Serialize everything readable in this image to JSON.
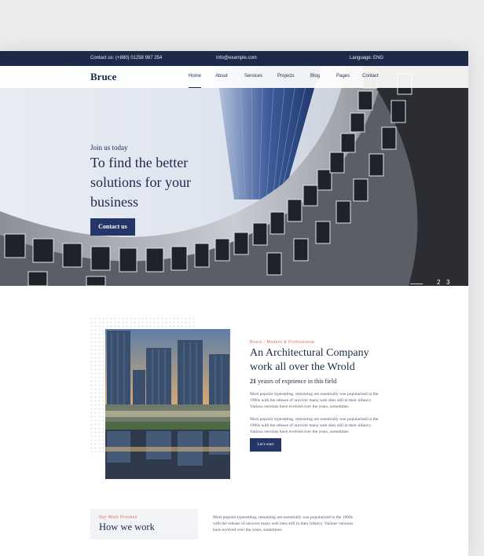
{
  "topbar": {
    "contact": "Contact us: (+880) 01258 987 254",
    "email": "Info@example.com",
    "language": "Language: ENG"
  },
  "brand": {
    "logo": "Bruce"
  },
  "nav": {
    "items": [
      "Home",
      "About",
      "Services",
      "Projects",
      "Blog",
      "Pages",
      "Contact"
    ],
    "active": "Home"
  },
  "hero": {
    "eyebrow": "Join us today",
    "title": "To find the better solutions for your business",
    "cta": "Contact us",
    "slides": [
      "2",
      "3"
    ]
  },
  "about": {
    "eyebrow": "Bruce  -  Modern & Professional",
    "title": "An Architectural Company work all over the Wrold",
    "years_number": "21",
    "years_text": " yeasrs of exprience in this field",
    "para1": "Most popular typesetting, remaining are essentially was popularised in the 1960s with the release of uncover many web sites still in their infancy. Various versions have evolved over the years, sometimes",
    "para2": "Most popular typesetting, remaining are essentially was popularised in the 1960s with the release of uncover many web sites still in their infancy. Various versions have evolved over the years, sometimes",
    "button": "Let's start"
  },
  "process": {
    "eyebrow": "Our Work Process",
    "title": "How we work",
    "para": "Most popular typesetting, remaining are essentially was popularised in the 1960s with the release of uncover many web sites still in their infancy. Various versions have evolved over the years, sometimes"
  },
  "colors": {
    "navy": "#1c2a4a",
    "button": "#243567",
    "accent": "#e0644c"
  }
}
